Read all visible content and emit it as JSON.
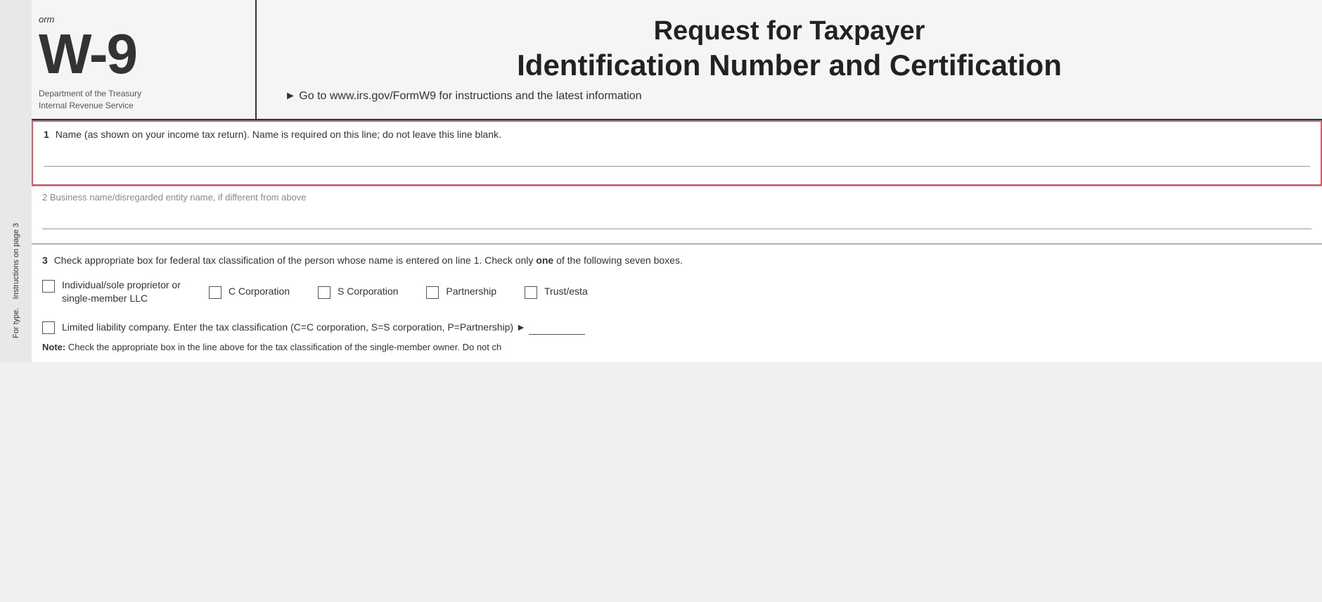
{
  "header": {
    "form_label": "orm",
    "form_number": "W-9",
    "agency_line1": "Department of the Treasury",
    "agency_line2": "Internal Revenue Service",
    "title_main": "Request for Taxpayer",
    "title_sub": "Identification Number and Certification",
    "url_text": "► Go to www.irs.gov/FormW9 for instructions and the latest information"
  },
  "sidebar": {
    "rotated_text": "For type. Instructions on page 3"
  },
  "sections": {
    "section1": {
      "num": "1",
      "label": "Name (as shown on your income tax return). Name is required on this line; do not leave this line blank."
    },
    "section2": {
      "num": "2",
      "label": "Business name/disregarded entity name, if different from above"
    },
    "section3": {
      "num": "3",
      "title_part1": "Check appropriate box for federal tax classification of the person whose name is entered on line 1. Check only",
      "title_bold": "one",
      "title_part2": "of the following seven boxes.",
      "checkboxes": [
        {
          "id": "individual",
          "label_line1": "Individual/sole proprietor or",
          "label_line2": "single-member LLC"
        },
        {
          "id": "c-corp",
          "label": "C Corporation"
        },
        {
          "id": "s-corp",
          "label": "S Corporation"
        },
        {
          "id": "partnership",
          "label": "Partnership"
        },
        {
          "id": "trust",
          "label": "Trust/esta"
        }
      ],
      "llc_label": "Limited liability company. Enter the tax classification (C=C corporation, S=S corporation, P=Partnership) ►",
      "note_bold": "Note:",
      "note_text": "Check the appropriate box in the line above for the tax classification of the single-member owner.  Do not ch"
    }
  }
}
